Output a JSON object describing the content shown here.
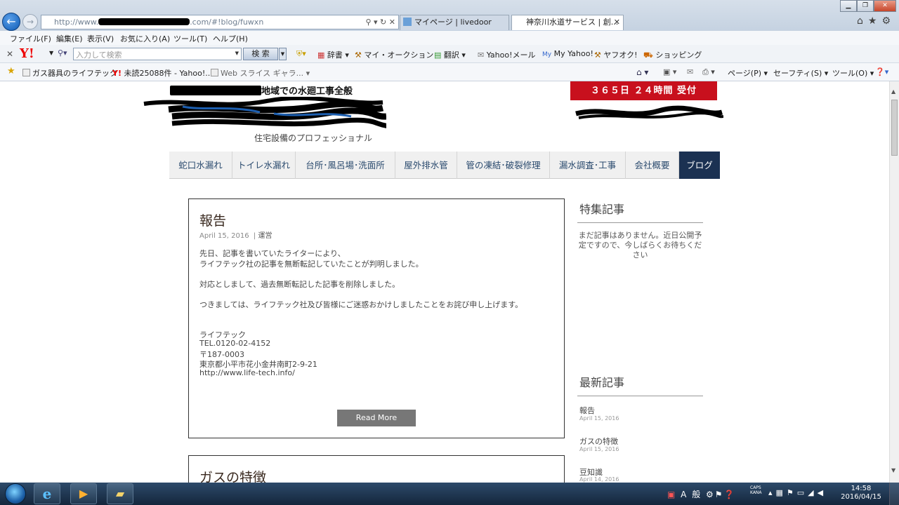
{
  "browser": {
    "address_url_prefix": "http://www.",
    "address_url_suffix": ".com/#!blog/fuwxn",
    "tabs": [
      {
        "label": "マイページ | livedoor Blog"
      },
      {
        "label": "神奈川水道サービス | 創..."
      }
    ],
    "menu": [
      "ファイル(F)",
      "編集(E)",
      "表示(V)",
      "お気に入り(A)",
      "ツール(T)",
      "ヘルプ(H)"
    ],
    "yahoo_toolbar": {
      "search_placeholder": "入力して検索",
      "search_button": "検 索",
      "links": [
        "辞書",
        "マイ・オークション",
        "翻訳",
        "Yahoo!メール",
        "My Yahoo!",
        "ヤフオク!",
        "ショッピング"
      ]
    },
    "favorites": [
      "ガス器具のライフテック",
      "未読25088件 - Yahoo!...",
      "Web スライス ギャラ..."
    ],
    "commands": [
      "ページ(P)",
      "セーフティ(S)",
      "ツール(O)"
    ]
  },
  "site": {
    "tagline": "地域での水廻工事全般",
    "subtitle": "住宅設備のプロフェッショナル",
    "badge": "３６５日 ２４時間 受付",
    "nav": [
      "蛇口水漏れ",
      "トイレ水漏れ",
      "台所･風呂場･洗面所",
      "屋外排水管",
      "管の凍結･破裂修理",
      "漏水調査･工事",
      "会社概要",
      "ブログ"
    ]
  },
  "posts": [
    {
      "title": "報告",
      "date": "April 15, 2016",
      "category": "運営",
      "lines": [
        "先日、記事を書いていたライターにより、",
        "ライフテック社の記事を無断転記していたことが判明しました。",
        "対応としまして、過去無断転記した記事を削除しました。",
        "つきましては、ライフテック社及び皆様にご迷惑おかけしましたことをお詫び申し上げます。",
        "ライフテック",
        "TEL.0120-02-4152",
        "〒187-0003",
        "東京都小平市花小金井南町2-9-21",
        "http://www.life-tech.info/"
      ],
      "read_more": "Read More"
    },
    {
      "title": "ガスの特徴"
    }
  ],
  "sidebar": {
    "featured_heading": "特集記事",
    "featured_empty": "まだ記事はありません。近日公開予定ですので、今しばらくお待ちください",
    "recent_heading": "最新記事",
    "recent": [
      {
        "title": "報告",
        "date": "April 15, 2016"
      },
      {
        "title": "ガスの特徴",
        "date": "April 15, 2016"
      },
      {
        "title": "豆知識",
        "date": "April 14, 2016"
      }
    ]
  },
  "taskbar": {
    "tray_text": "A 般",
    "caps": "CAPS",
    "kana": "KANA",
    "time": "14:58",
    "date": "2016/04/15"
  }
}
